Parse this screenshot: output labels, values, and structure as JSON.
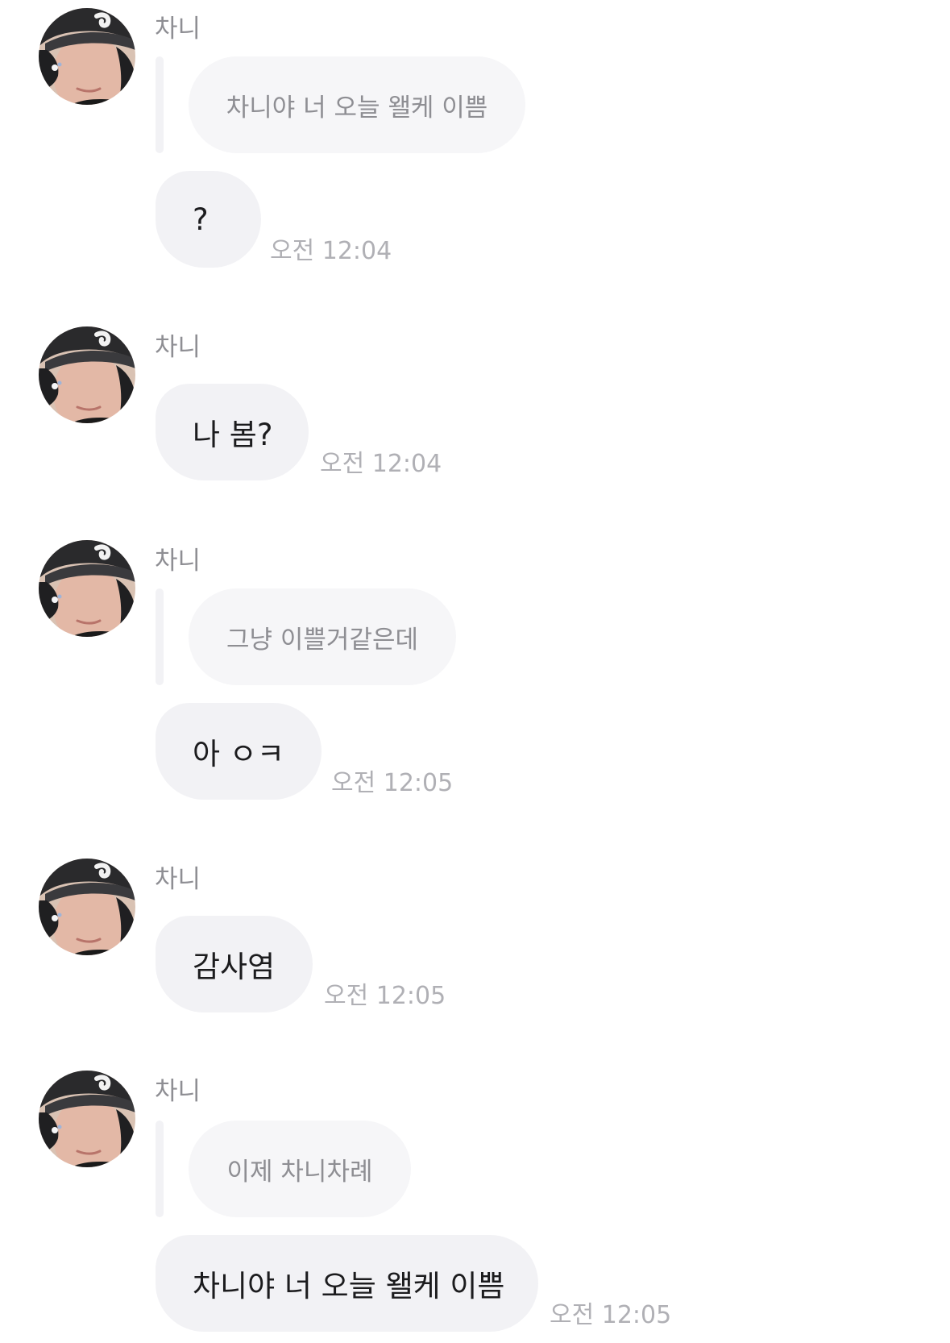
{
  "messages": [
    {
      "sender": "차니",
      "reply_quote": "차니야 너 오늘 왤케 이쁨",
      "text": "?",
      "time": "오전 12:04"
    },
    {
      "sender": "차니",
      "text": "나 봄?",
      "time": "오전 12:04"
    },
    {
      "sender": "차니",
      "reply_quote": "그냥 이쁠거같은데",
      "text": "아 ㅇㅋ",
      "time": "오전 12:05"
    },
    {
      "sender": "차니",
      "text": "감사염",
      "time": "오전 12:05"
    },
    {
      "sender": "차니",
      "reply_quote": "이제 차니차례",
      "text": "차니야 너 오늘 왤케 이쁨",
      "time": "오전 12:05"
    }
  ]
}
